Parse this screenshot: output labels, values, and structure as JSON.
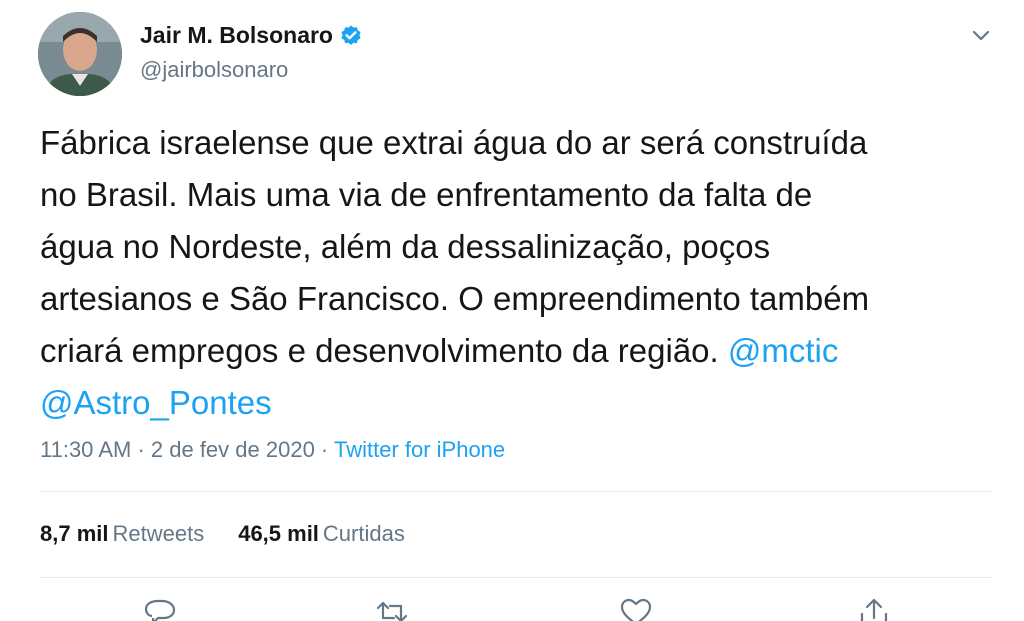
{
  "author": {
    "display_name": "Jair M. Bolsonaro",
    "handle": "@jairbolsonaro",
    "verified": true
  },
  "tweet": {
    "lines": [
      "Fábrica israelense que extrai água do ar será construída",
      "no Brasil. Mais uma via de enfrentamento da falta de",
      "água no Nordeste, além da dessalinização, poços",
      "artesianos e São Francisco. O empreendimento também",
      "criará empregos e desenvolvimento da região. "
    ],
    "mentions": [
      "@mctic",
      "@Astro_Pontes"
    ]
  },
  "meta": {
    "time": "11:30 AM",
    "separator1": " · ",
    "date": "2 de fev de 2020",
    "separator2": " · ",
    "source": "Twitter for iPhone"
  },
  "stats": {
    "retweets_value": "8,7 mil",
    "retweets_label": "Retweets",
    "likes_value": "46,5 mil",
    "likes_label": "Curtidas"
  },
  "colors": {
    "accent": "#1da1f2",
    "text": "#14171a",
    "muted": "#657786",
    "divider": "#e6ecf0"
  },
  "icons": {
    "verified": "verified-badge-icon",
    "caret": "chevron-down-icon",
    "reply": "reply-icon",
    "retweet": "retweet-icon",
    "like": "heart-icon",
    "share": "share-icon"
  }
}
